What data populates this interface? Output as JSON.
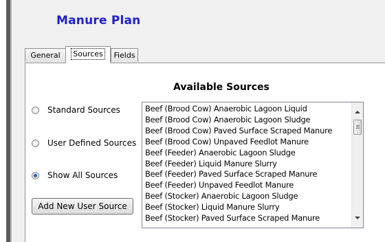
{
  "app": {
    "title": "Manure Plan"
  },
  "tabs": [
    {
      "label": "General"
    },
    {
      "label": "Sources",
      "active": true
    },
    {
      "label": "Fields"
    }
  ],
  "section_title": "Available Sources",
  "filter": {
    "options": [
      {
        "label": "Standard Sources",
        "checked": false
      },
      {
        "label": "User Defined Sources",
        "checked": false
      },
      {
        "label": "Show All Sources",
        "checked": true
      }
    ]
  },
  "add_button": "Add New User Source",
  "sources": [
    "Beef (Brood Cow)  Anaerobic Lagoon Liquid",
    "Beef (Brood Cow)  Anaerobic Lagoon Sludge",
    "Beef (Brood Cow) Paved Surface Scraped Manure",
    "Beef (Brood Cow) Unpaved Feedlot Manure",
    "Beef (Feeder)  Anaerobic Lagoon Sludge",
    "Beef (Feeder) Liquid Manure Slurry",
    "Beef (Feeder) Paved Surface Scraped Manure",
    "Beef (Feeder) Unpaved Feedlot Manure",
    "Beef (Stocker)  Anaerobic Lagoon Sludge",
    "Beef (Stocker) Liquid Manure Slurry",
    "Beef (Stocker) Paved Surface Scraped Manure"
  ],
  "colors": {
    "title": "#1f1fd0",
    "radio_selected": "#1d5fb8"
  },
  "icons": {
    "scroll_up": "chevron-up-icon",
    "scroll_down": "chevron-down-icon"
  }
}
